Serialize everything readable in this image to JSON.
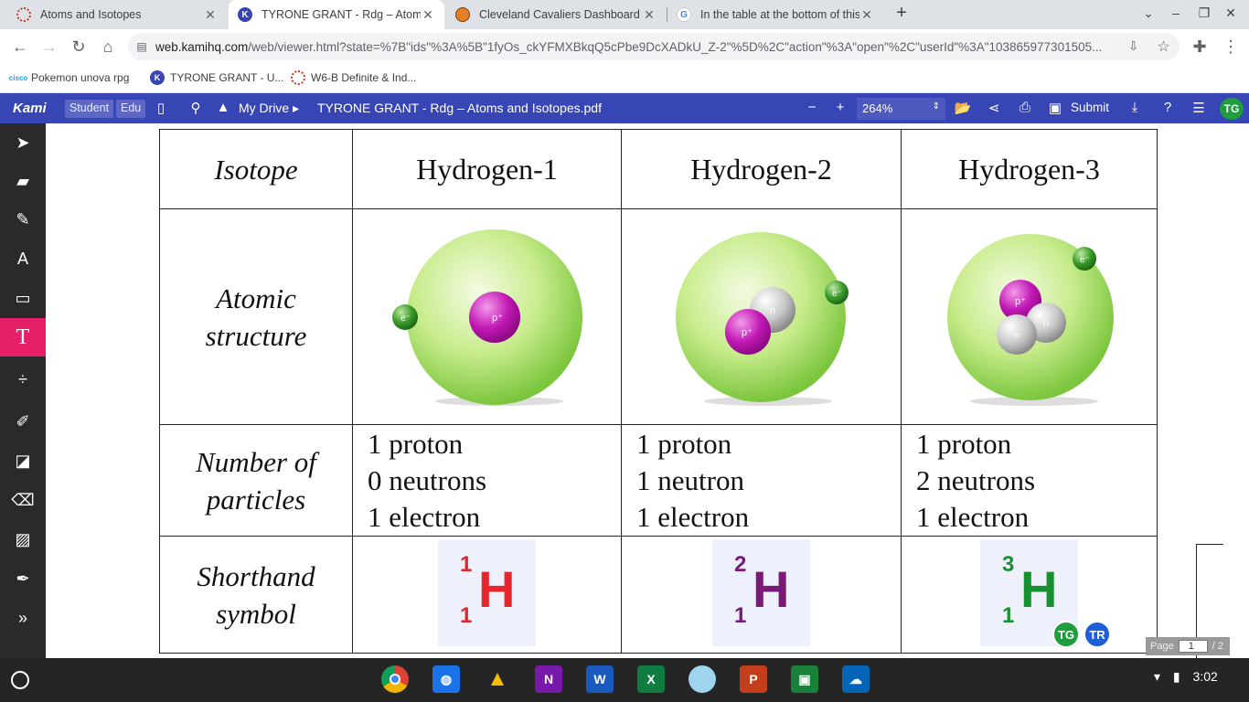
{
  "browser": {
    "tabs": [
      {
        "title": "Atoms and Isotopes",
        "favicon": "cisco-ring-icon",
        "active": false
      },
      {
        "title": "TYRONE GRANT - Rdg – Atoms a",
        "favicon": "kami-icon",
        "active": true
      },
      {
        "title": "Cleveland Cavaliers Dashboard",
        "favicon": "basketball-icon",
        "active": false
      },
      {
        "title": "In the table at the bottom of this",
        "favicon": "google-icon",
        "active": false
      }
    ],
    "new_tab": "+",
    "url_host": "web.kamihq.com",
    "url_path": "/web/viewer.html?state=%7B\"ids\"%3A%5B\"1fyOs_ckYFMXBkqQ5cPbe9DcXADkU_Z-2\"%5D%2C\"action\"%3A\"open\"%2C\"userId\"%3A\"103865977301505...",
    "bookmarks": [
      "Pokemon unova rpg",
      "TYRONE GRANT - U...",
      "W6-B Definite & Ind..."
    ]
  },
  "kami": {
    "logo": "Kami",
    "badges": [
      "Student",
      "Edu"
    ],
    "drive_label": "My Drive",
    "document_title": "TYRONE GRANT - Rdg – Atoms and Isotopes.pdf",
    "zoom": "264%",
    "submit_label": "Submit",
    "user_initials": "TG",
    "font_size": "9",
    "colors": {
      "accent": "#3745b5",
      "active_tool": "#e61f69",
      "swatch1": "#000000",
      "swatch2": "#e00000",
      "swatch3": "#ff8c00"
    }
  },
  "table": {
    "row_labels": [
      "Isotope",
      "Atomic structure",
      "Number of particles",
      "Shorthand symbol"
    ],
    "isotopes": [
      {
        "name": "Hydrogen-1",
        "particles": [
          "1 proton",
          "0 neutrons",
          "1 electron"
        ],
        "mass": "1",
        "atomic": "1",
        "symbol": "H",
        "symbol_color": "#e8252a"
      },
      {
        "name": "Hydrogen-2",
        "particles": [
          "1 proton",
          "1 neutron",
          "1 electron"
        ],
        "mass": "2",
        "atomic": "1",
        "symbol": "H",
        "symbol_color": "#7a1a77"
      },
      {
        "name": "Hydrogen-3",
        "particles": [
          "1 proton",
          "2 neutrons",
          "1 electron"
        ],
        "mass": "3",
        "atomic": "1",
        "symbol": "H",
        "symbol_color": "#17912f"
      }
    ],
    "particle_labels": {
      "proton": "p⁺",
      "neutron": "n",
      "electron": "e⁻"
    }
  },
  "collaborators": [
    "TG",
    "TR"
  ],
  "page_indicator": {
    "label": "Page",
    "current": "1",
    "total": "/ 2"
  },
  "shelf": {
    "time": "3:02"
  }
}
